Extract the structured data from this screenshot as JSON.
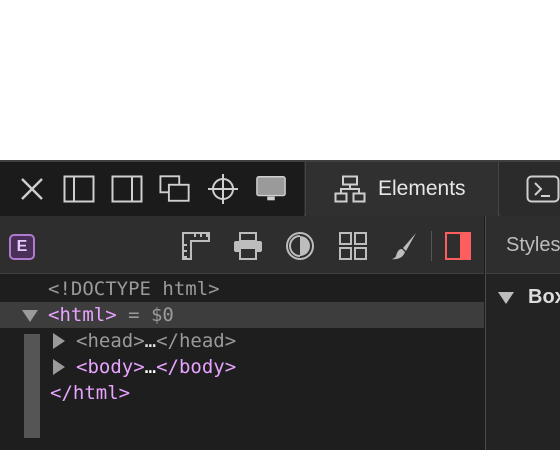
{
  "tabbar": {
    "left_icons": [
      "close-icon",
      "dock-left-icon",
      "dock-right-icon",
      "undock-icon",
      "inspect-icon",
      "device-icon"
    ],
    "tabs": [
      {
        "label": "Elements",
        "icon": "elements-icon",
        "selected": true
      },
      {
        "label": "",
        "icon": "console-icon",
        "selected": false
      }
    ]
  },
  "toolbar": {
    "badge": "E",
    "icons": [
      "ruler-icon",
      "print-icon",
      "appearance-icon",
      "grid-icon",
      "brush-icon",
      "sidebar-toggle-icon"
    ],
    "accent_color": "#ff5e5e"
  },
  "sidebar": {
    "tab_label": "Styles",
    "section_label": "Box"
  },
  "dom_tree": {
    "rows": [
      {
        "text": "<!DOCTYPE html>"
      },
      {
        "open": "<html>",
        "suffix": " = $0"
      },
      {
        "open": "<head>",
        "ellipsis": "…",
        "close": "</head>"
      },
      {
        "open": "<body>",
        "ellipsis": "…",
        "close": "</body>"
      },
      {
        "close": "</html>"
      }
    ]
  },
  "colors": {
    "tag": "#e8a3ff",
    "muted": "#9a9a9a",
    "selection": "#3d3d3d"
  }
}
